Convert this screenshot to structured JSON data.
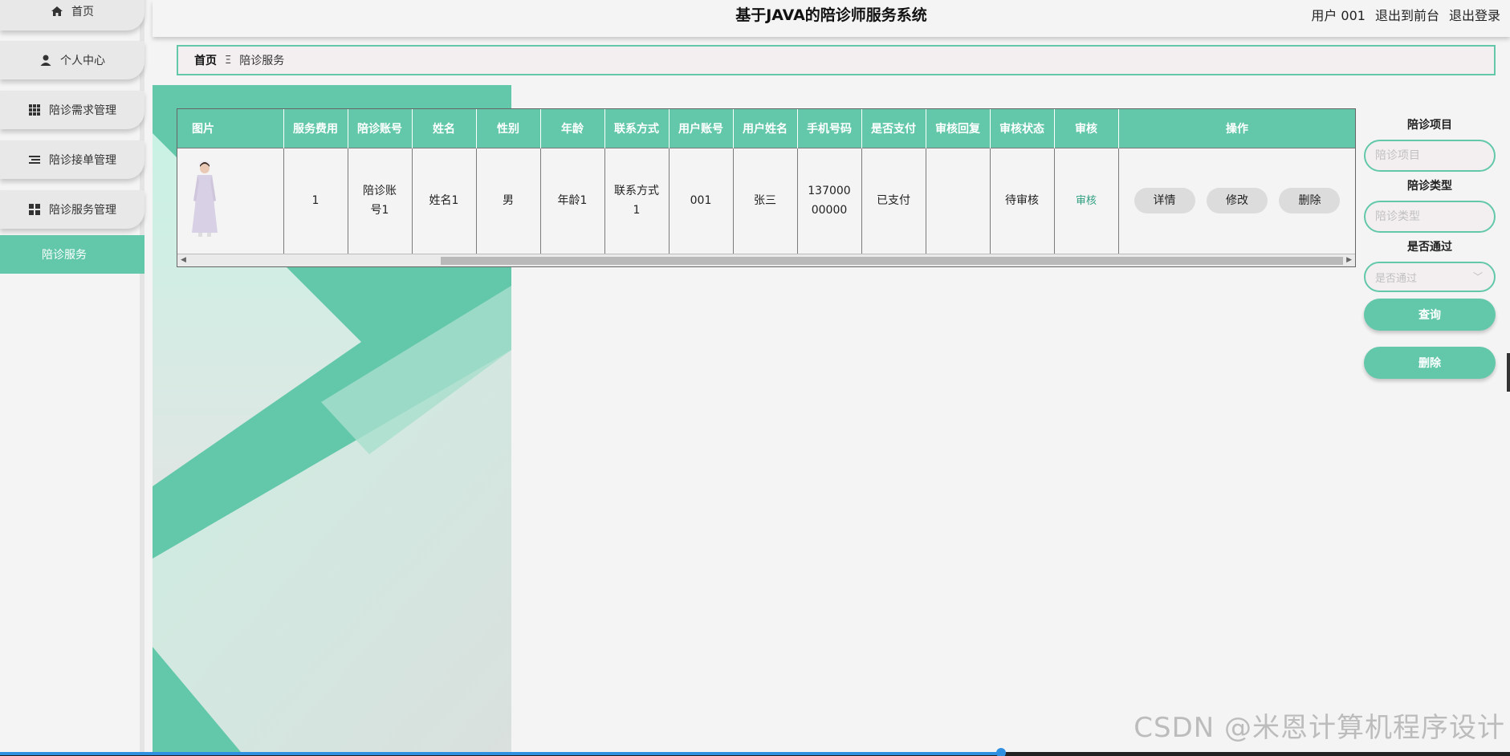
{
  "sidebar": {
    "items": [
      {
        "label": "首页",
        "icon": "home-icon"
      },
      {
        "label": "个人中心",
        "icon": "user-icon"
      },
      {
        "label": "陪诊需求管理",
        "icon": "grid-icon"
      },
      {
        "label": "陪诊接单管理",
        "icon": "list-icon"
      },
      {
        "label": "陪诊服务管理",
        "icon": "apps-icon"
      }
    ],
    "active_item": "陪诊服务"
  },
  "header": {
    "title": "基于JAVA的陪诊师服务系统",
    "user_label": "用户 001",
    "to_front": "退出到前台",
    "logout": "退出登录"
  },
  "breadcrumb": {
    "home": "首页",
    "separator": "Ξ",
    "current": "陪诊服务"
  },
  "table": {
    "headers": [
      "图片",
      "服务费用",
      "陪诊账号",
      "姓名",
      "性别",
      "年龄",
      "联系方式",
      "用户账号",
      "用户姓名",
      "手机号码",
      "是否支付",
      "审核回复",
      "审核状态",
      "审核",
      "操作"
    ],
    "rows": [
      {
        "fee": "1",
        "account": "陪诊账号1",
        "name": "姓名1",
        "gender": "男",
        "age": "年龄1",
        "contact": "联系方式1",
        "user_account": "001",
        "user_name": "张三",
        "phone": "13700000000",
        "paid": "已支付",
        "reply": "",
        "status": "待审核",
        "audit": "审核",
        "actions": [
          "详情",
          "修改",
          "删除"
        ]
      }
    ]
  },
  "search": {
    "project_label": "陪诊项目",
    "project_placeholder": "陪诊项目",
    "type_label": "陪诊类型",
    "type_placeholder": "陪诊类型",
    "pass_label": "是否通过",
    "pass_placeholder": "是否通过",
    "query_button": "查询",
    "delete_button": "删除"
  },
  "watermark": "CSDN @米恩计算机程序设计",
  "colors": {
    "accent": "#63c8aa",
    "background": "#f4f4f4",
    "link": "#2f9e7f"
  }
}
